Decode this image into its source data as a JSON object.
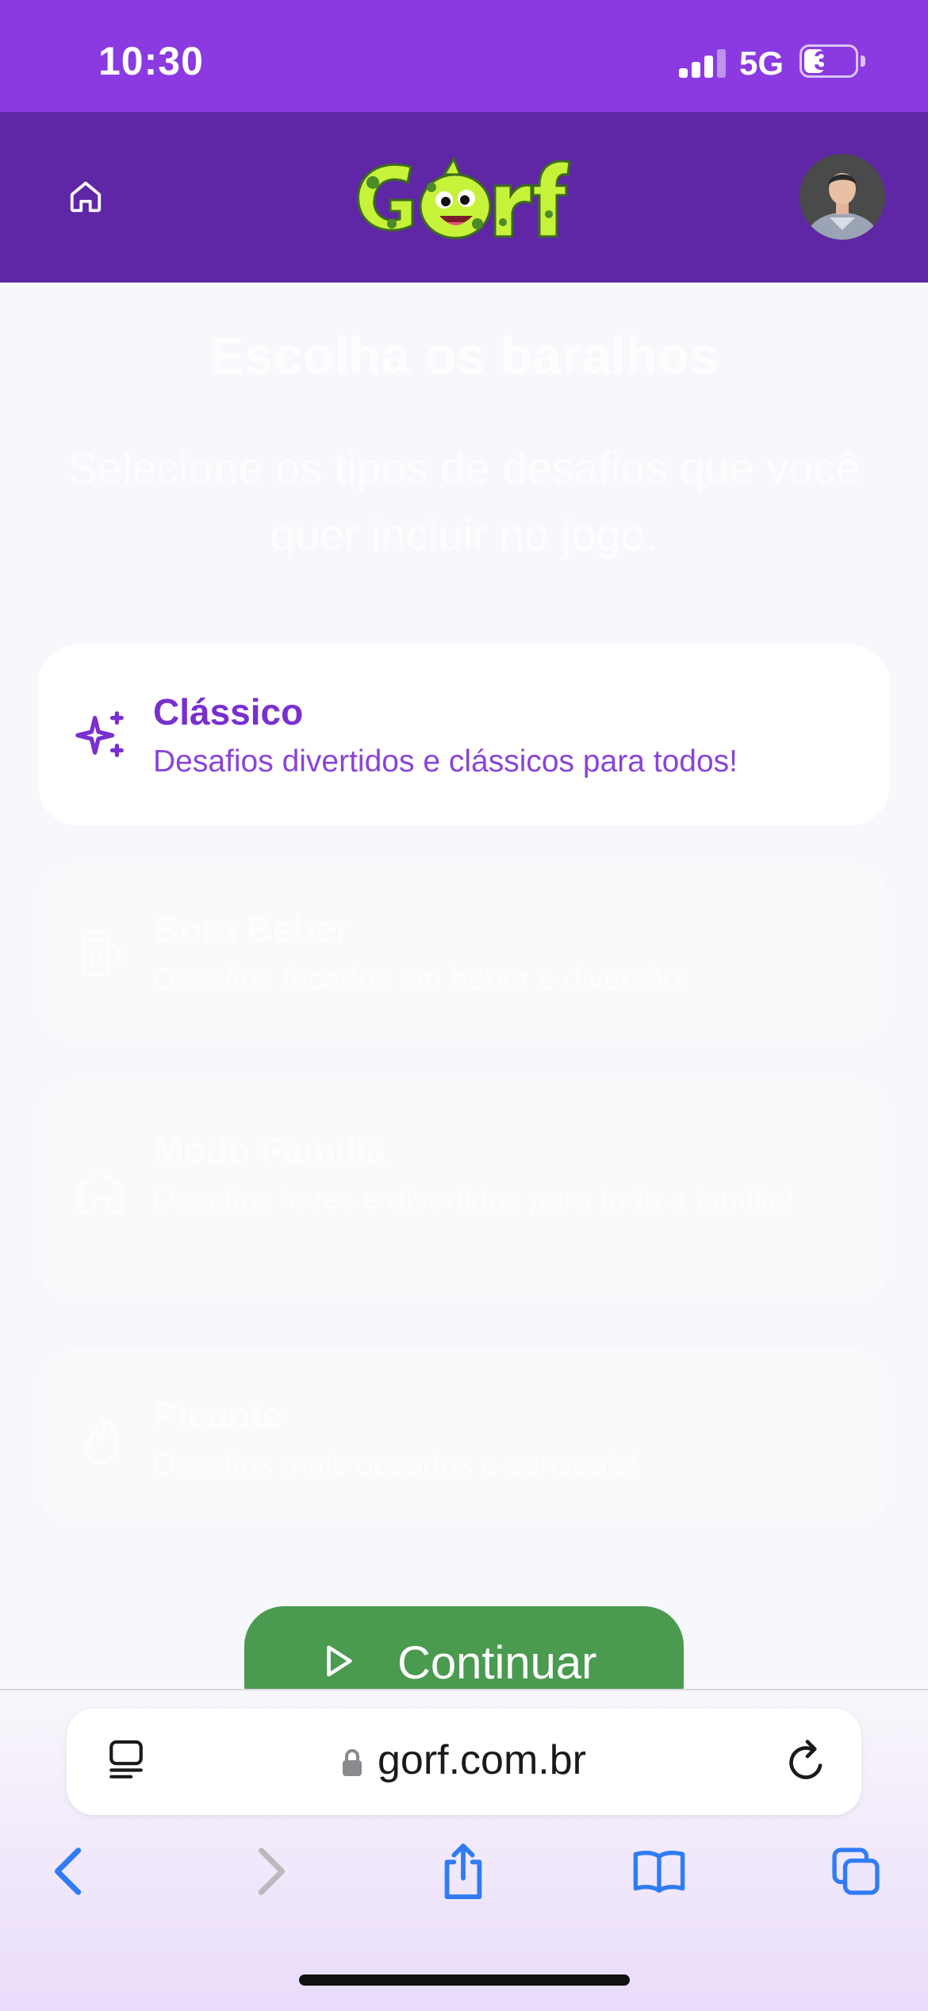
{
  "status_bar": {
    "time": "10:30",
    "network": "5G",
    "battery": "36",
    "battery_fraction": 0.36,
    "signal_bars_active": 3
  },
  "header": {
    "home_icon": "home-icon",
    "logo_text": "Gorf",
    "avatar": "user-avatar"
  },
  "page": {
    "title": "Escolha os baralhos",
    "subtitle": "Selecione os tipos de desafios que você quer incluir no jogo."
  },
  "decks": [
    {
      "name": "Clássico",
      "description": "Desafios divertidos e clássicos para todos!",
      "icon": "sparkles-icon",
      "selected": true
    },
    {
      "name": "Bora Beber",
      "description": "Desafios focados em beber e diversão!",
      "icon": "beer-mug-icon",
      "selected": false
    },
    {
      "name": "Modo Família",
      "description": "Desafios leves e divertidos para toda a família!",
      "icon": "house-icon",
      "selected": false
    },
    {
      "name": "Picante",
      "description": "Desafios mais ousados e sensuais!",
      "icon": "flame-icon",
      "selected": false
    }
  ],
  "continue_button": {
    "label": "Continuar",
    "icon": "play-icon"
  },
  "browser": {
    "url": "gorf.com.br",
    "icons": [
      "reader-icon",
      "lock-icon",
      "reload-icon",
      "back-icon",
      "forward-icon",
      "share-icon",
      "bookmarks-icon",
      "tabs-icon"
    ]
  },
  "colors": {
    "status_bar": "#8a3ae0",
    "header": "#5f26a6",
    "logo": "#c7f23a",
    "accent": "#7a2fcf",
    "continue": "#4a9a4f",
    "safari_blue": "#2f7cf6"
  }
}
